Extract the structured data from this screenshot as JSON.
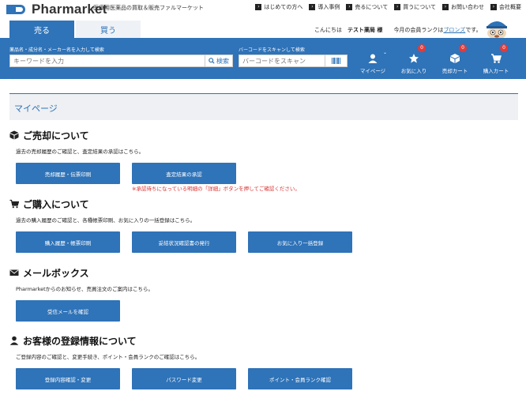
{
  "header": {
    "logo_text": "Pharmarket",
    "tagline": "医療用医薬品の買取＆販売ファルマーケット",
    "links": [
      {
        "label": "はじめての方へ"
      },
      {
        "label": "導入事例"
      },
      {
        "label": "売るについて"
      },
      {
        "label": "買うについて"
      },
      {
        "label": "お問い合わせ"
      },
      {
        "label": "会社概要"
      }
    ]
  },
  "tabs": [
    {
      "label": "売る",
      "active": true
    },
    {
      "label": "買う",
      "active": false
    }
  ],
  "greeting": {
    "prefix": "こんにちは",
    "user": "テスト薬局 様",
    "rank_prefix": "今月の会員ランクは",
    "rank": "ブロンズ",
    "rank_suffix": "です。"
  },
  "search": {
    "keyword_label": "薬品名・成分名・メーカー名を入力して検索",
    "keyword_placeholder": "キーワードを入力",
    "search_button": "検索",
    "barcode_label": "バーコードをスキャンして検索",
    "barcode_placeholder": "バーコードをスキャン"
  },
  "nav": [
    {
      "label": "マイページ",
      "icon": "user-icon",
      "badge": ""
    },
    {
      "label": "お気に入り",
      "icon": "star-icon",
      "badge": "0"
    },
    {
      "label": "売却カート",
      "icon": "box-icon",
      "badge": "0"
    },
    {
      "label": "購入カート",
      "icon": "cart-icon",
      "badge": "0"
    }
  ],
  "page_title": "マイページ",
  "sections": {
    "sell": {
      "title": "ご売却について",
      "desc": "過去の売却履歴のご確認と、査定結果の承認はこちら。",
      "buttons": [
        "売却履歴・伝票印刷",
        "査定結果の承認"
      ],
      "notice": "※承認待ちになっている明細の「詳細」ボタンを押してご確認ください。"
    },
    "buy": {
      "title": "ご購入について",
      "desc": "過去の購入履歴のご確認と、各種帳票印刷、お気に入りの一括登録はこちら。",
      "buttons": [
        "購入履歴・帳票印刷",
        "妥結状況確認書の発行",
        "お気に入り一括登録"
      ]
    },
    "mail": {
      "title": "メールボックス",
      "desc": "Pharmarketからのお知らせ、売買注文のご案内はこちら。",
      "buttons": [
        "受信メールを確認"
      ]
    },
    "account": {
      "title": "お客様の登録情報について",
      "desc": "ご登録内容のご確認と、変更手続き、ポイント・会員ランクのご確認はこちら。",
      "buttons": [
        "登録内容確認・変更",
        "パスワード変更",
        "ポイント・会員ランク確認"
      ]
    }
  },
  "colors": {
    "primary": "#2f73b8",
    "notice": "#d93030",
    "badge": "#e23b3b"
  }
}
